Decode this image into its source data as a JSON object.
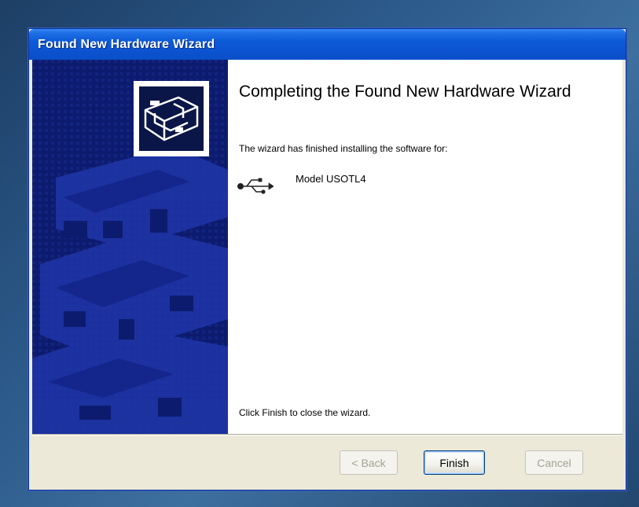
{
  "window": {
    "title": "Found New Hardware Wizard"
  },
  "main": {
    "heading": "Completing the Found New Hardware Wizard",
    "intro": "The wizard has finished installing the software for:",
    "device_name": "Model USOTL4",
    "device_icon": "usb-icon",
    "closing": "Click Finish to close the wizard."
  },
  "side_panel": {
    "icon": "hardware-device-icon",
    "color": "#0d1b6f"
  },
  "buttons": {
    "back": "< Back",
    "finish": "Finish",
    "cancel": "Cancel"
  },
  "colors": {
    "titlebar": "#0b52cf",
    "dialog_bg": "#ece9d8",
    "default_button_border": "#003c74"
  }
}
